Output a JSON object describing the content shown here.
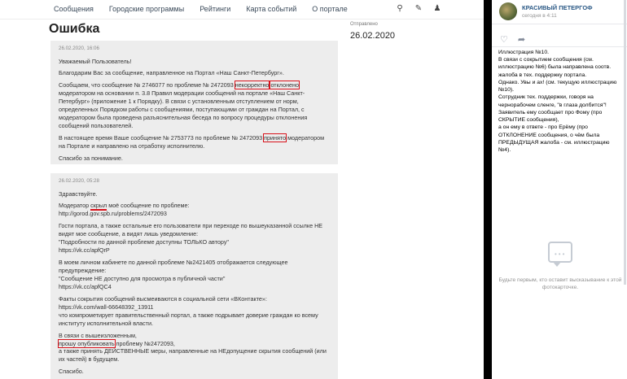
{
  "portal": {
    "nav": [
      "Сообщения",
      "Городские программы",
      "Рейтинги",
      "Карта событий",
      "О портале"
    ],
    "icons": [
      "search-icon",
      "pencil-icon",
      "user-icon"
    ],
    "title": "Ошибка",
    "sent_label": "Отправлено",
    "sent_date": "26.02.2020"
  },
  "message1": {
    "date": "26.02.2020, 16:06",
    "greeting": "Уважаемый Пользователь!",
    "thanks": "Благодарим Вас за сообщение, направленное на Портал «Наш Санкт-Петербург».",
    "p1_a": "Сообщаем, что сообщение № 2746077 по проблеме № 2472093 ",
    "p1_hl1": "некорректно",
    "p1_b": " ",
    "p1_hl2": "отклонено",
    "p1_c": " модератором на основании п. 3.8 Правил модерации сообщений на портале «Наш Санкт-Петербург» (приложение 1 к Порядку). В связи с установленным отступлением от норм, определенных Порядком работы с сообщениями, поступающими от граждан на Портал, с модератором была проведена разъяснительная беседа по вопросу процедуры отклонения сообщений пользователей.",
    "p2_a": "В настоящее время Ваше сообщение № 2753773 по проблеме № 2472093 ",
    "p2_hl": "принято",
    "p2_b": " модератором на Портале и направлено на отработку исполнителю.",
    "bye": "Спасибо за понимание."
  },
  "message2": {
    "date": "26.02.2020, 05:28",
    "hello": "Здравствуйте.",
    "l1_a": "Модератор ",
    "l1_ul": "скрыл",
    "l1_b": " моё сообщение по проблеме:",
    "l1_link": "http://gorod.gov.spb.ru/problems/2472093",
    "l2": "Гости портала, а также остальные его пользователи при переходе по вышеуказанной ссылке НЕ видят мое сообщение, а видят лишь уведомление:",
    "l2_q": "\"Подробности по данной проблеме доступны ТОЛЬКО автору\"",
    "l2_link": "https://vk.cc/apfQrP",
    "l3": "В моем личном кабинете по данной проблеме №2421405 отображается следующее предупреждение:",
    "l3_q": "\"Сообщение НЕ доступно для просмотра в публичной части\"",
    "l3_link": "https://vk.cc/apfQC4",
    "l4": "Факты сокрытия сообщений высмеиваются в социальной сети «ВКонтакте»:",
    "l4_link": "https://vk.com/wall-66648392_13911",
    "l4_b": "что компрометирует правительственный портал, а также подрывает доверие граждан ко всему институту исполнительной власти.",
    "l5": "В связи с вышеизложенным,",
    "l5_hl": "прошу опубликовать",
    "l5_b": " проблему №2472093,",
    "l5_c": "а также принять ДЕЙСТВЕННЫЕ меры, направленные на НЕдопущение скрытия сообщений (или их частей) в будущем.",
    "bye": "Спасибо."
  },
  "post": {
    "author": "КРАСИВЫЙ ПЕТЕРГОФ",
    "time": "сегодня в 4:11",
    "like_icon": "heart-icon",
    "share_icon": "share-icon",
    "text": "Иллюстрация №10.\nВ связи с сокрытием сообщения (см. иллюстрацию №6) была направлена соотв. жалоба в тех. поддержку портала.\nОднако. Увы и ах! (см. текущую иллюстрацию №10).\nСотрудник тех. поддержки, говоря на чернорабочем сленге, \"в глаза долбится\"!\nЗаявитель ему сообщает про Фому (про СКРЫТИЕ сообщения),\nа он ему в ответе - про Ерёму (про ОТКЛОНЕНИЕ сообщения, о чём была ПРЕДЫДУЩАЯ жалоба - см. иллюстрацию №4).",
    "empty_icon": "comment-bubble-icon",
    "empty_text": "Будьте первым, кто оставит высказывание к этой фотокарточке."
  }
}
